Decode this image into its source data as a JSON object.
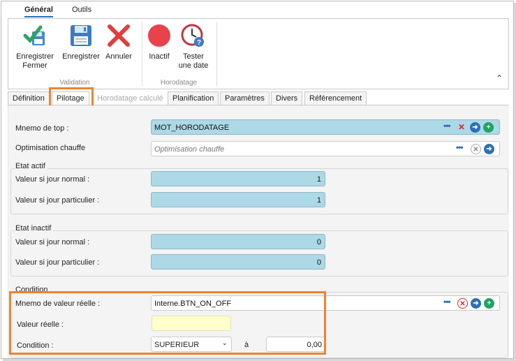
{
  "ribbon": {
    "tabs": [
      "Général",
      "Outils"
    ],
    "buttons": {
      "save_close": "Enregistrer\nFermer",
      "save": "Enregistrer",
      "cancel": "Annuler",
      "inactive": "Inactif",
      "test_date": "Tester\nune date"
    },
    "groups": {
      "validation": "Validation",
      "timestamp": "Horodatage"
    }
  },
  "page_tabs": [
    "Définition",
    "Pilotage",
    "Horodatage calculé",
    "Planification",
    "Paramètres",
    "Divers",
    "Référencement"
  ],
  "form": {
    "top_mnemo": {
      "label": "Mnemo de top :",
      "value": "MOT_HORODATAGE"
    },
    "heating_opt": {
      "label": "Optimisation chauffe",
      "placeholder": "Optimisation chauffe"
    },
    "active_state": {
      "title": "Etat actif",
      "normal_label": "Valeur si jour normal :",
      "normal_value": "1",
      "special_label": "Valeur si jour particulier :",
      "special_value": "1"
    },
    "inactive_state": {
      "title": "Etat inactif",
      "normal_label": "Valeur si jour normal :",
      "normal_value": "0",
      "special_label": "Valeur si jour particulier :",
      "special_value": "0"
    },
    "condition": {
      "title": "Condition",
      "mnemo_label": "Mnemo de valeur réelle :",
      "mnemo_value": "Interne.BTN_ON_OFF",
      "real_label": "Valeur réelle :",
      "real_value": "",
      "cond_label": "Condition :",
      "cond_value": "SUPERIEUR",
      "to_label": "à",
      "threshold": "0,00"
    }
  },
  "colors": {
    "accent": "#2d6fb7",
    "highlight": "#f0832f",
    "field_blue": "#add8e6",
    "field_yellow": "#ffffcc"
  }
}
